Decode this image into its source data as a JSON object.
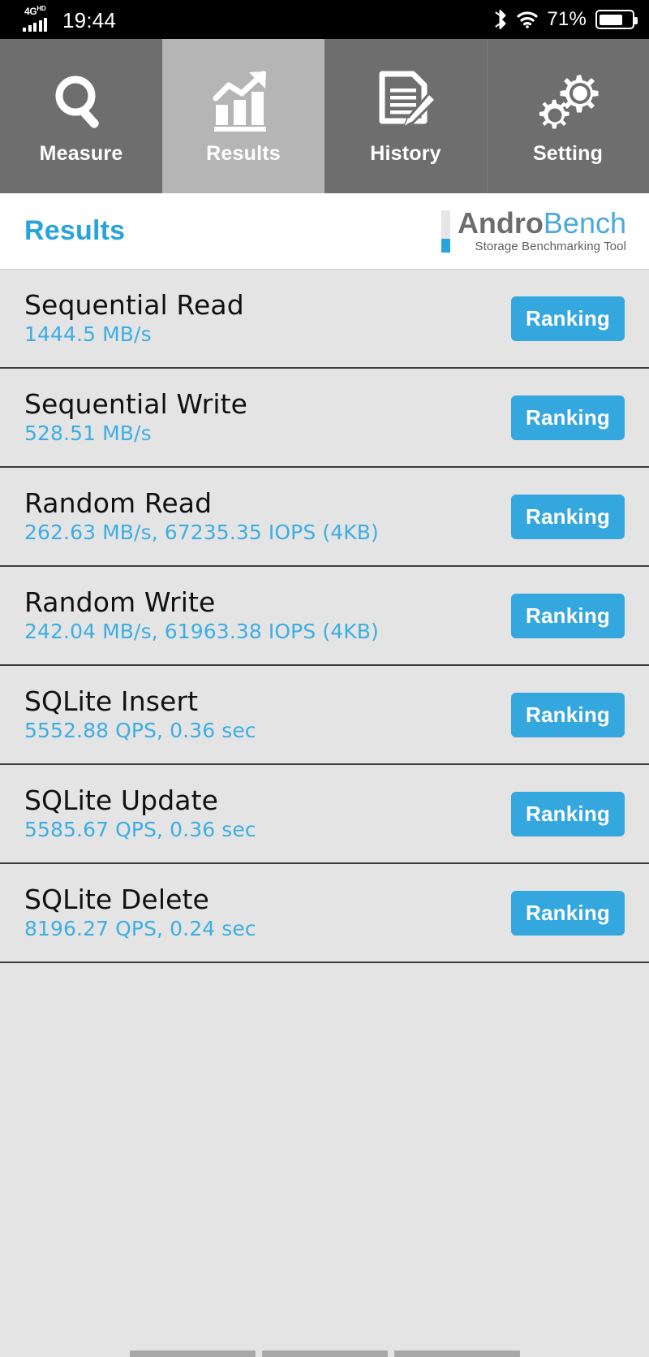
{
  "status_bar": {
    "network_label": "4G",
    "network_sup": "HD",
    "time": "19:44",
    "bluetooth_icon": "bluetooth-icon",
    "wifi_icon": "wifi-icon",
    "battery_percent": "71%",
    "battery_level": 71
  },
  "tabs": [
    {
      "label": "Measure",
      "icon": "magnifier-icon",
      "active": false
    },
    {
      "label": "Results",
      "icon": "bar-chart-arrow-icon",
      "active": true
    },
    {
      "label": "History",
      "icon": "document-pencil-icon",
      "active": false
    },
    {
      "label": "Setting",
      "icon": "gears-icon",
      "active": false
    }
  ],
  "header": {
    "title": "Results",
    "logo_andro": "Andro",
    "logo_bench": "Bench",
    "logo_tagline": "Storage Benchmarking Tool"
  },
  "results": [
    {
      "title": "Sequential Read",
      "value": "1444.5 MB/s",
      "button": "Ranking"
    },
    {
      "title": "Sequential Write",
      "value": "528.51 MB/s",
      "button": "Ranking"
    },
    {
      "title": "Random Read",
      "value": "262.63 MB/s, 67235.35 IOPS (4KB)",
      "button": "Ranking"
    },
    {
      "title": "Random Write",
      "value": "242.04 MB/s, 61963.38 IOPS (4KB)",
      "button": "Ranking"
    },
    {
      "title": "SQLite Insert",
      "value": "5552.88 QPS, 0.36 sec",
      "button": "Ranking"
    },
    {
      "title": "SQLite Update",
      "value": "5585.67 QPS, 0.36 sec",
      "button": "Ranking"
    },
    {
      "title": "SQLite Delete",
      "value": "8196.27 QPS, 0.24 sec",
      "button": "Ranking"
    }
  ],
  "colors": {
    "accent_blue": "#34a7de",
    "value_blue": "#3daee4",
    "title_blue": "#2aa3dd",
    "tab_inactive": "#6e6e6e",
    "tab_active": "#b5b5b5",
    "list_bg": "#e4e4e4",
    "separator": "#3b3b3b"
  },
  "bottom_nav": {
    "pills": 3
  }
}
